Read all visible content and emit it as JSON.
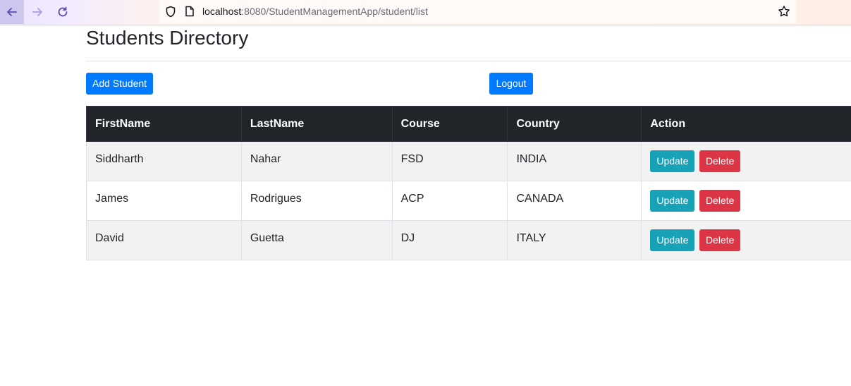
{
  "browser": {
    "url_host": "localhost",
    "url_path": ":8080/StudentManagementApp/student/list"
  },
  "page": {
    "title": "Students Directory",
    "add_label": "Add Student",
    "logout_label": "Logout"
  },
  "table": {
    "headers": [
      "FirstName",
      "LastName",
      "Course",
      "Country",
      "Action"
    ],
    "rows": [
      [
        "Siddharth",
        "Nahar",
        "FSD",
        "INDIA"
      ],
      [
        "James",
        "Rodrigues",
        "ACP",
        "CANADA"
      ],
      [
        "David",
        "Guetta",
        "DJ",
        "ITALY"
      ]
    ],
    "update_label": "Update",
    "delete_label": "Delete"
  },
  "colors": {
    "primary": "#007bff",
    "info": "#17a2b8",
    "danger": "#dc3545",
    "header_dark": "#212529"
  },
  "icons": [
    "back-arrow-icon",
    "forward-arrow-icon",
    "reload-icon",
    "shield-icon",
    "page-icon",
    "bookmark-star-icon"
  ]
}
